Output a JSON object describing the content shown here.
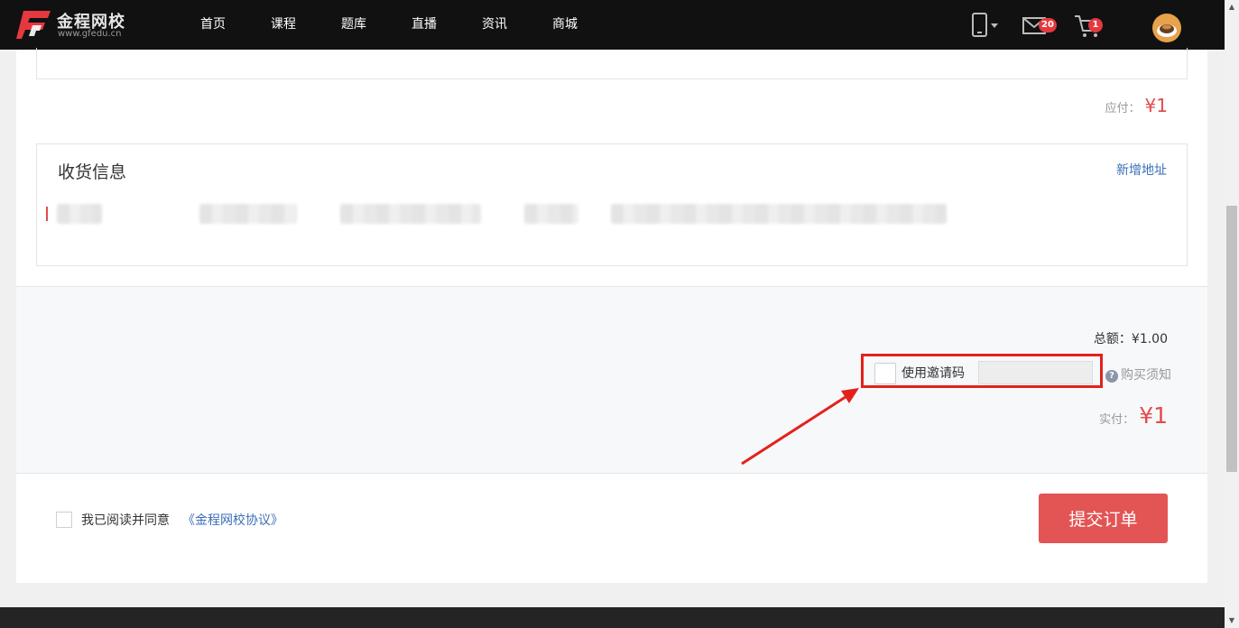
{
  "brand": {
    "name": "金程网校",
    "domain": "www.gfedu.cn"
  },
  "nav": [
    "首页",
    "课程",
    "题库",
    "直播",
    "资讯",
    "商城"
  ],
  "header_icons": {
    "phone": "mobile-icon",
    "mail": "mail-icon",
    "cart": "cart-icon",
    "avatar": "user-avatar"
  },
  "badges": {
    "mail": "20",
    "cart": "1"
  },
  "order": {
    "due_label": "应付：",
    "due_amount": "¥1"
  },
  "shipping": {
    "title": "收货信息",
    "add_address": "新增地址"
  },
  "summary": {
    "total_label": "总额：",
    "total_value": "¥1.00",
    "invite_label": "使用邀请码",
    "invite_value": "",
    "notice": "购买须知",
    "paid_label": "实付：",
    "paid_amount": "¥1"
  },
  "agreement": {
    "text": "我已阅读并同意",
    "link": "《金程网校协议》"
  },
  "submit": "提交订单",
  "colors": {
    "accent": "#e34b4b",
    "link": "#3a6fb7",
    "highlight": "#e3211c",
    "topbar": "#111111"
  }
}
